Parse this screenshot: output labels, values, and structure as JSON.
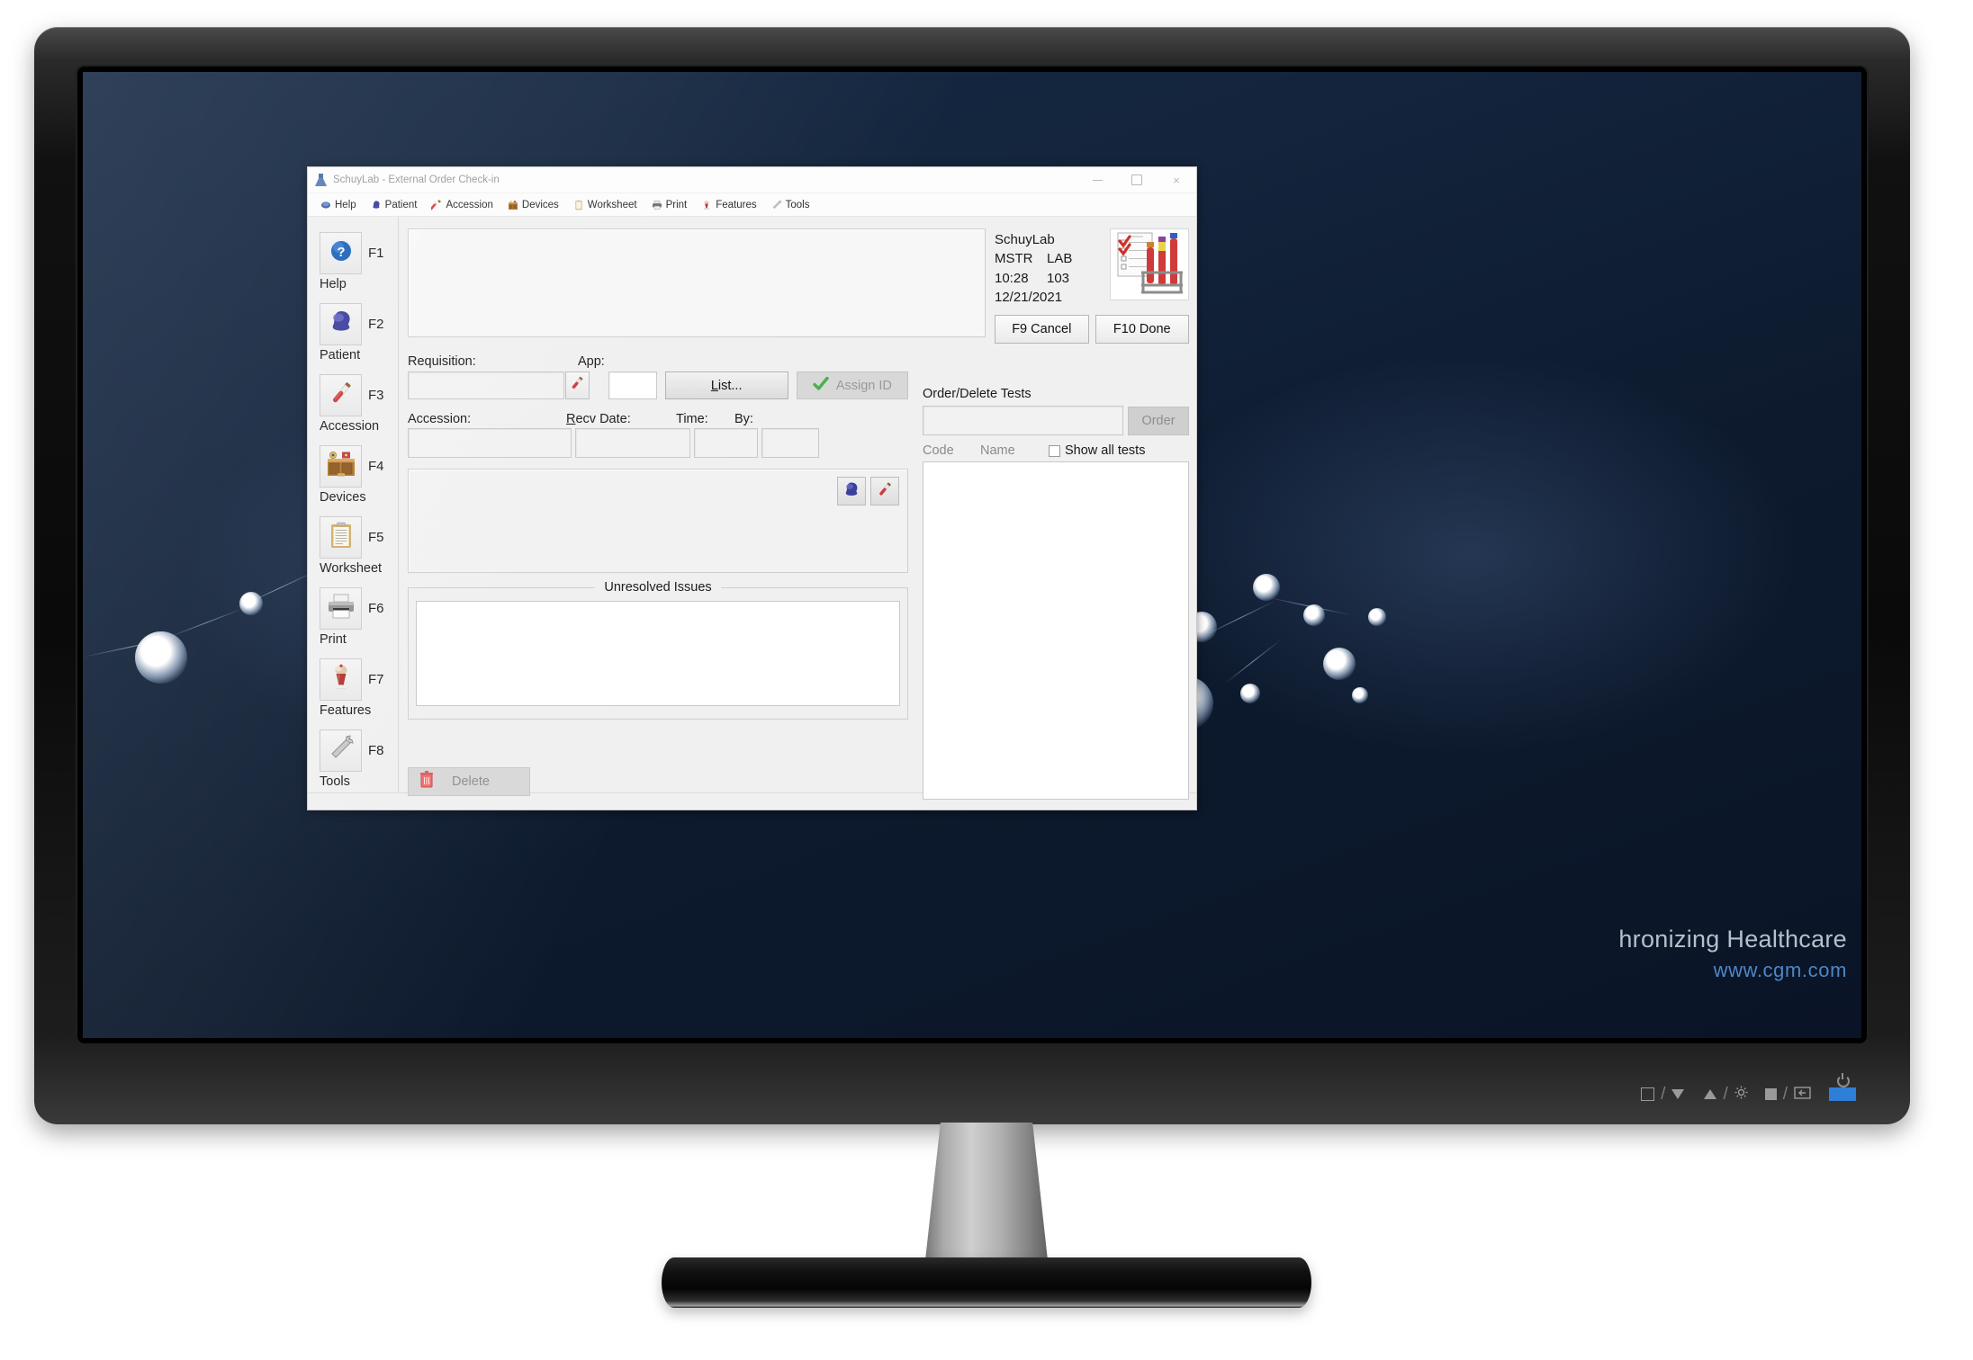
{
  "window": {
    "title": "SchuyLab - External Order Check-in",
    "app_icon": "flask-icon",
    "controls": {
      "minimize": "—",
      "maximize": "❐",
      "close": "×"
    }
  },
  "menubar": [
    {
      "label": "Help",
      "icon": "help-dot-icon"
    },
    {
      "label": "Patient",
      "icon": "patient-head-icon"
    },
    {
      "label": "Accession",
      "icon": "blood-tube-icon"
    },
    {
      "label": "Devices",
      "icon": "cabinet-icon"
    },
    {
      "label": "Worksheet",
      "icon": "clipboard-icon"
    },
    {
      "label": "Print",
      "icon": "printer-icon"
    },
    {
      "label": "Features",
      "icon": "sundae-icon"
    },
    {
      "label": "Tools",
      "icon": "wrench-icon"
    }
  ],
  "sidebar": {
    "items": [
      {
        "key": "F1",
        "label": "Help",
        "icon": "question-circle-icon"
      },
      {
        "key": "F2",
        "label": "Patient",
        "icon": "patient-head-icon"
      },
      {
        "key": "F3",
        "label": "Accession",
        "icon": "blood-tube-icon"
      },
      {
        "key": "F4",
        "label": "Devices",
        "icon": "cabinet-icon"
      },
      {
        "key": "F5",
        "label": "Worksheet",
        "icon": "clipboard-icon"
      },
      {
        "key": "F6",
        "label": "Print",
        "icon": "printer-icon"
      },
      {
        "key": "F7",
        "label": "Features",
        "icon": "sundae-icon"
      },
      {
        "key": "F8",
        "label": "Tools",
        "icon": "wrench-icon"
      }
    ]
  },
  "info": {
    "product": "SchuyLab",
    "user": "MSTR",
    "lab": "LAB",
    "time": "10:28",
    "station": "103",
    "date": "12/21/2021",
    "logo_icon": "requisition-tubes-icon",
    "cancel_label": "F9 Cancel",
    "done_label": "F10 Done"
  },
  "form": {
    "requisition_label": "Requisition:",
    "requisition_value": "",
    "requisition_placeholder": "",
    "requisition_pick_icon": "blood-tube-icon",
    "app_label": "App:",
    "app_value": "",
    "list_label": "List...",
    "assign_label": "Assign ID",
    "assign_icon": "green-check-icon",
    "accession_label": "Accession:",
    "accession_value": "",
    "recv_date_label": "Recv Date:",
    "recv_date_value": "",
    "time_label": "Time:",
    "time_value": "",
    "by_label": "By:",
    "by_value": "",
    "detail_patient_icon": "patient-head-icon",
    "detail_tube_icon": "blood-tube-icon"
  },
  "issues": {
    "legend": "Unresolved Issues",
    "content": ""
  },
  "delete": {
    "label": "Delete",
    "icon": "trash-icon"
  },
  "tests": {
    "title": "Order/Delete Tests",
    "search_value": "",
    "order_label": "Order",
    "col_code": "Code",
    "col_name": "Name",
    "show_all_label": "Show all tests",
    "show_all_checked": false,
    "rows": []
  },
  "desktop": {
    "watermark_line1": "hronizing Healthcare",
    "watermark_line2": "www.cgm.com",
    "watermark_color": "#4f86c6"
  },
  "monitor_osd": {
    "buttons": [
      "input-icon",
      "down-icon",
      "up-icon",
      "brightness-icon",
      "menu-icon",
      "back-icon",
      "power-icon"
    ]
  }
}
